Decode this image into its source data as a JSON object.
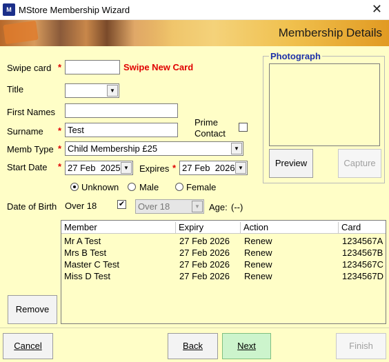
{
  "window": {
    "title": "MStore Membership Wizard",
    "app_icon_text": "M"
  },
  "banner": {
    "heading": "Membership Details"
  },
  "form": {
    "swipe_card_label": "Swipe card",
    "swipe_card_value": "",
    "swipe_new_card": "Swipe New Card",
    "title_label": "Title",
    "title_value": "",
    "first_names_label": "First Names",
    "first_names_value": "",
    "surname_label": "Surname",
    "surname_value": "Test",
    "prime_contact_label_1": "Prime",
    "prime_contact_label_2": "Contact",
    "prime_contact_checked": false,
    "memb_type_label": "Memb Type",
    "memb_type_value": "Child Membership £25",
    "start_date_label": "Start Date",
    "start_date_value": "27 Feb  2025",
    "expires_label": "Expires",
    "expires_value": "27 Feb  2026",
    "gender_options": [
      "Unknown",
      "Male",
      "Female"
    ],
    "gender_selected": "Unknown",
    "dob_label": "Date of Birth",
    "dob_text": "Over 18",
    "dob_checked": true,
    "dob_combo_value": "Over 18",
    "age_label": "Age:",
    "age_value": "(--)",
    "required_marker": "*"
  },
  "photograph": {
    "legend": "Photograph",
    "preview_label": "Preview",
    "capture_label": "Capture"
  },
  "members": {
    "columns": [
      "Member",
      "Expiry",
      "Action",
      "Card"
    ],
    "rows": [
      [
        "Mr A Test",
        "27 Feb 2026",
        "Renew",
        "1234567A"
      ],
      [
        "Mrs B Test",
        "27 Feb 2026",
        "Renew",
        "1234567B"
      ],
      [
        "Master C Test",
        "27 Feb 2026",
        "Renew",
        "1234567C"
      ],
      [
        "Miss D Test",
        "27 Feb 2026",
        "Renew",
        "1234567D"
      ]
    ],
    "remove_label": "Remove"
  },
  "footer": {
    "cancel_label": "Cancel",
    "back_label": "Back",
    "next_label": "Next",
    "finish_label": "Finish"
  },
  "colors": {
    "form_bg": "#fffec7",
    "required": "#e00000",
    "legend": "#1b2fa8",
    "next_bg": "#ccf4cc"
  },
  "icons": {
    "close": "close-icon",
    "dropdown": "chevron-down-icon",
    "check": "checkmark-icon"
  }
}
